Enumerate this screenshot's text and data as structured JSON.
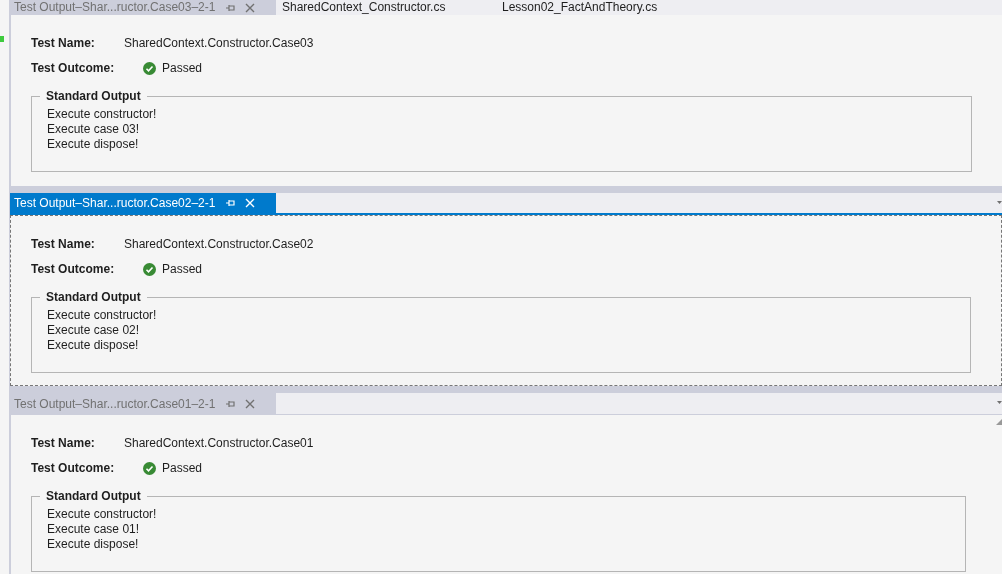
{
  "top_tabs": [
    {
      "title": "Test Output–Shar...ructor.Case03–2-1",
      "selected": false,
      "kind": "output"
    },
    {
      "title": "SharedContext_Constructor.cs",
      "selected": false,
      "kind": "file"
    },
    {
      "title": "Lesson02_FactAndTheory.cs",
      "selected": false,
      "kind": "file"
    }
  ],
  "panels": [
    {
      "name_label": "Test Name:",
      "name": "SharedContext.Constructor.Case03",
      "outcome_label": "Test Outcome:",
      "outcome": "Passed",
      "passed": true,
      "output_label": "Standard Output",
      "lines": [
        "Execute constructor!",
        "Execute case 03!",
        "Execute dispose!"
      ]
    },
    {
      "tab": {
        "title": "Test Output–Shar...ructor.Case02–2-1",
        "selected": true
      },
      "name_label": "Test Name:",
      "name": "SharedContext.Constructor.Case02",
      "outcome_label": "Test Outcome:",
      "outcome": "Passed",
      "passed": true,
      "output_label": "Standard Output",
      "lines": [
        "Execute constructor!",
        "Execute case 02!",
        "Execute dispose!"
      ]
    },
    {
      "tab": {
        "title": "Test Output–Shar...ructor.Case01–2-1",
        "selected": false
      },
      "name_label": "Test Name:",
      "name": "SharedContext.Constructor.Case01",
      "outcome_label": "Test Outcome:",
      "outcome": "Passed",
      "passed": true,
      "output_label": "Standard Output",
      "lines": [
        "Execute constructor!",
        "Execute case 01!",
        "Execute dispose!"
      ]
    }
  ]
}
